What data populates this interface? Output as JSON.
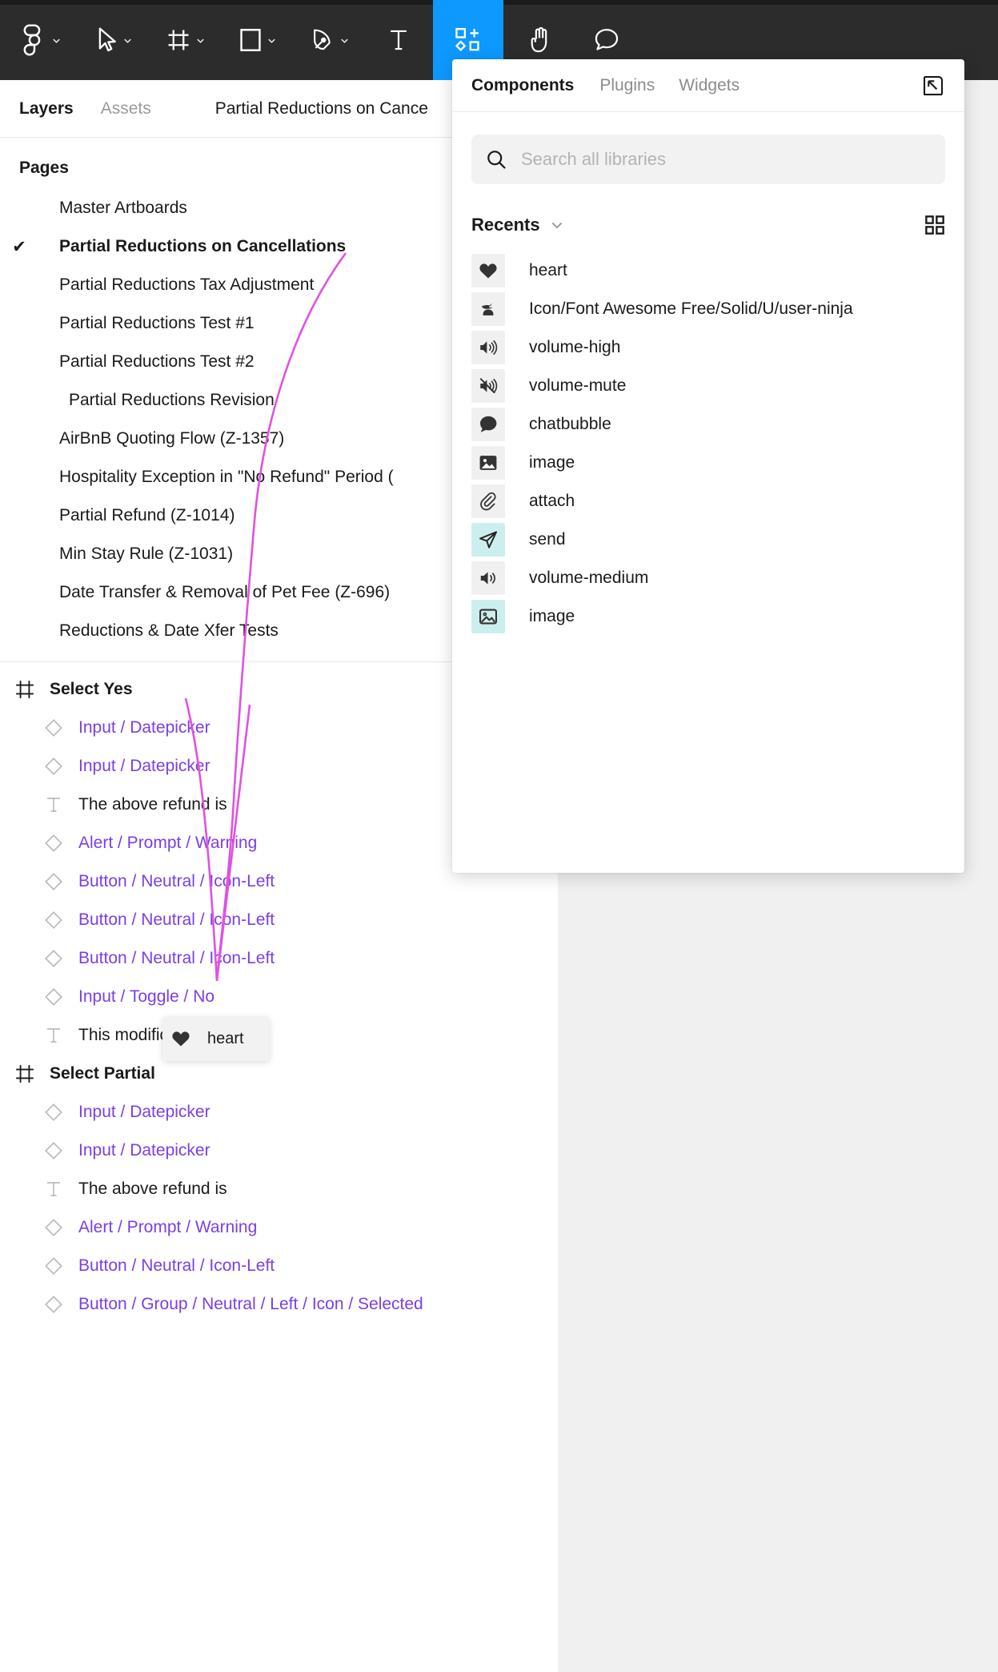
{
  "toolbar": {
    "items": [
      {
        "name": "figma-logo-icon",
        "label": "Figma menu",
        "has_caret": true,
        "active": false
      },
      {
        "name": "move-tool-icon",
        "label": "Move",
        "has_caret": true,
        "active": false
      },
      {
        "name": "frame-tool-icon",
        "label": "Frame",
        "has_caret": true,
        "active": false
      },
      {
        "name": "shape-tool-icon",
        "label": "Rectangle",
        "has_caret": true,
        "active": false
      },
      {
        "name": "pen-tool-icon",
        "label": "Pen",
        "has_caret": true,
        "active": false
      },
      {
        "name": "text-tool-icon",
        "label": "Text",
        "has_caret": false,
        "active": false
      },
      {
        "name": "resources-tool-icon",
        "label": "Resources",
        "has_caret": false,
        "active": true
      },
      {
        "name": "hand-tool-icon",
        "label": "Hand",
        "has_caret": false,
        "active": false
      },
      {
        "name": "comment-tool-icon",
        "label": "Comment",
        "has_caret": false,
        "active": false
      }
    ],
    "accent_color": "#0d99ff",
    "background_color": "#2c2c2c"
  },
  "left_panel": {
    "tabs": [
      {
        "label": "Layers",
        "active": true
      },
      {
        "label": "Assets",
        "active": false
      }
    ],
    "document_title": "Partial Reductions on Cance",
    "pages_heading": "Pages",
    "pages": [
      {
        "label": "Master Artboards",
        "selected": false,
        "indent": false
      },
      {
        "label": "Partial Reductions on Cancellations",
        "selected": true,
        "indent": false
      },
      {
        "label": "Partial Reductions Tax Adjustment",
        "selected": false,
        "indent": false
      },
      {
        "label": "Partial Reductions Test #1",
        "selected": false,
        "indent": false
      },
      {
        "label": "Partial Reductions Test #2",
        "selected": false,
        "indent": false
      },
      {
        "label": "Partial Reductions Revision",
        "selected": false,
        "indent": true
      },
      {
        "label": "AirBnB Quoting Flow (Z-1357)",
        "selected": false,
        "indent": false
      },
      {
        "label": "Hospitality Exception in \"No Refund\" Period (",
        "selected": false,
        "indent": false
      },
      {
        "label": "Partial Refund (Z-1014)",
        "selected": false,
        "indent": false
      },
      {
        "label": "Min Stay Rule (Z-1031)",
        "selected": false,
        "indent": false
      },
      {
        "label": "Date Transfer & Removal of Pet Fee (Z-696)",
        "selected": false,
        "indent": false
      },
      {
        "label": "Reductions & Date Xfer Tests",
        "selected": false,
        "indent": false
      }
    ],
    "check_glyph": "✔",
    "layers": [
      {
        "label": "Select Yes",
        "type": "frame"
      },
      {
        "label": "Input / Datepicker",
        "type": "component"
      },
      {
        "label": "Input / Datepicker",
        "type": "component"
      },
      {
        "label": "The above refund is",
        "type": "text"
      },
      {
        "label": "Alert / Prompt / Warning",
        "type": "component"
      },
      {
        "label": "Button / Neutral / Icon-Left",
        "type": "component"
      },
      {
        "label": "Button / Neutral / Icon-Left",
        "type": "component"
      },
      {
        "label": "Button / Neutral / Icon-Left",
        "type": "component"
      },
      {
        "label": "Input / Toggle / No",
        "type": "component"
      },
      {
        "label": "This modificaiton is",
        "type": "text"
      },
      {
        "label": "Select Partial",
        "type": "frame"
      },
      {
        "label": "Input / Datepicker",
        "type": "component"
      },
      {
        "label": "Input / Datepicker",
        "type": "component"
      },
      {
        "label": "The above refund is",
        "type": "text"
      },
      {
        "label": "Alert / Prompt / Warning",
        "type": "component"
      },
      {
        "label": "Button / Neutral / Icon-Left",
        "type": "component"
      },
      {
        "label": "Button / Group / Neutral / Left / Icon / Selected",
        "type": "component"
      }
    ],
    "component_color": "#7b3fe4"
  },
  "components_panel": {
    "tabs": [
      {
        "label": "Components",
        "active": true
      },
      {
        "label": "Plugins",
        "active": false
      },
      {
        "label": "Widgets",
        "active": false
      }
    ],
    "expand_icon": "expand-panel-icon",
    "search": {
      "placeholder": "Search all libraries",
      "value": "",
      "icon": "search-icon"
    },
    "section": {
      "label": "Recents",
      "caret_icon": "chevron-down-icon",
      "grid_toggle_icon": "grid-view-icon"
    },
    "items": [
      {
        "label": "heart",
        "icon": "heart-icon",
        "highlighted": false
      },
      {
        "label": "Icon/Font Awesome Free/Solid/U/user-ninja",
        "icon": "user-ninja-icon",
        "highlighted": false
      },
      {
        "label": "volume-high",
        "icon": "volume-high-icon",
        "highlighted": false
      },
      {
        "label": "volume-mute",
        "icon": "volume-mute-icon",
        "highlighted": false
      },
      {
        "label": "chatbubble",
        "icon": "chatbubble-icon",
        "highlighted": false
      },
      {
        "label": "image",
        "icon": "image-icon",
        "highlighted": false
      },
      {
        "label": "attach",
        "icon": "attach-icon",
        "highlighted": false
      },
      {
        "label": "send",
        "icon": "send-icon",
        "highlighted": true
      },
      {
        "label": "volume-medium",
        "icon": "volume-medium-icon",
        "highlighted": false
      },
      {
        "label": "image",
        "icon": "image-outline-icon",
        "highlighted": true
      }
    ],
    "highlight_color": "#cdeeee"
  },
  "drag_ghost": {
    "label": "heart",
    "icon": "heart-icon"
  },
  "connector": {
    "color": "#e052e0"
  }
}
